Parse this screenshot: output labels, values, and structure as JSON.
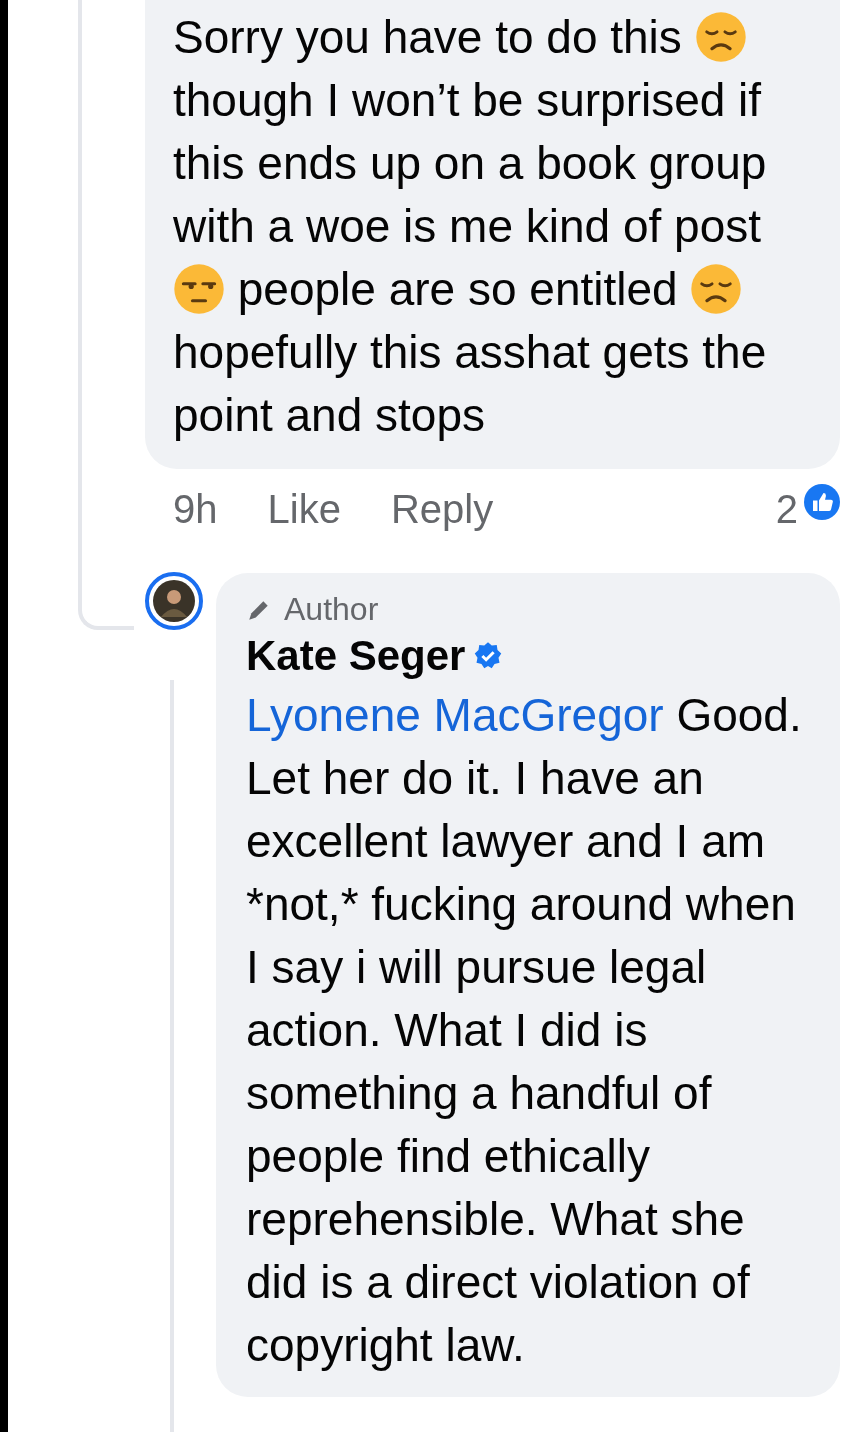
{
  "comment": {
    "body": [
      {
        "kind": "text",
        "text": "Sorry you have to do this "
      },
      {
        "kind": "sad_emoji"
      },
      {
        "kind": "text",
        "text": " though I won’t be surprised if this ends up on a book group with a woe is me kind of post"
      },
      {
        "kind": "unamused_emoji"
      },
      {
        "kind": "text",
        "text": " people are so entitled "
      },
      {
        "kind": "sad_emoji"
      },
      {
        "kind": "text",
        "text": " hopefully this asshat gets the point and stops"
      }
    ],
    "time": "9h",
    "actions": [
      "Like",
      "Reply"
    ],
    "reaction_count": "2"
  },
  "reply": {
    "badge": "Author",
    "author": "Kate Seger",
    "verified": true,
    "mention": "Lyonene MacGregor",
    "text": "Good. Let her do it. I have an excellent lawyer and I am *not,* fucking around when I say i will pursue legal action. What I did is something a handful of people find ethically reprehensible. What she did is a direct violation of copyright law."
  }
}
